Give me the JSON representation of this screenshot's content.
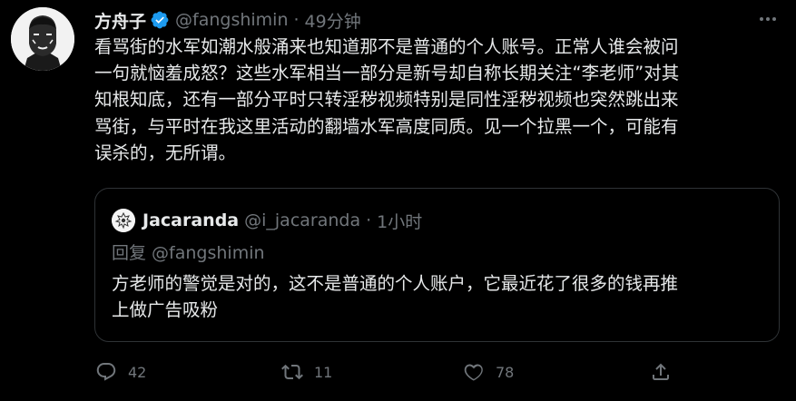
{
  "tweet": {
    "author_name": "方舟子",
    "handle": "@fangshimin",
    "separator": "·",
    "time": "49分钟",
    "verified": true,
    "text": "看骂街的水军如潮水般涌来也知道那不是普通的个人账号。正常人谁会被问\n一句就恼羞成怒？这些水军相当一部分是新号却自称长期关注“李老师”对其\n知根知底，还有一部分平时只转淫秽视频特别是同性淫秽视频也突然跳出来\n骂街，与平时在我这里活动的翻墙水军高度同质。见一个拉黑一个，可能有\n误杀的，无所谓。"
  },
  "quoted": {
    "author_name": "Jacaranda",
    "handle": "@i_jacaranda",
    "separator": "·",
    "time": "1小时",
    "reply_to": "回复 @fangshimin",
    "text": "方老师的警觉是对的，这不是普通的个人账户，它最近花了很多的钱再推\n上做广告吸粉"
  },
  "actions": {
    "reply_count": "42",
    "retweet_count": "11",
    "like_count": "78",
    "share_count": ""
  },
  "icons": {
    "verified": "verified-badge-icon",
    "more": "more-options-icon",
    "reply": "reply-icon",
    "retweet": "retweet-icon",
    "like": "heart-icon",
    "share": "share-icon"
  },
  "colors": {
    "background": "#000000",
    "text": "#e7e9ea",
    "secondary": "#71767b",
    "verified": "#1d9bf0",
    "border": "#2f3336"
  }
}
